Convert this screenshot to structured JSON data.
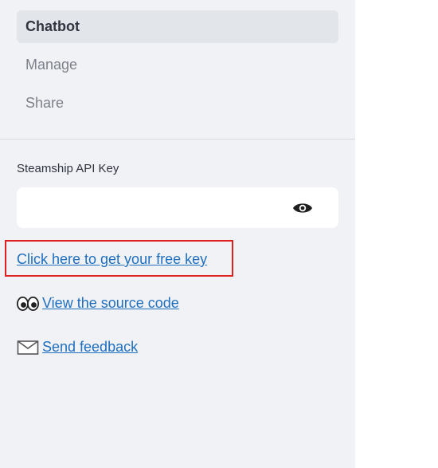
{
  "sidebar": {
    "nav": [
      {
        "label": "Chatbot",
        "active": true
      },
      {
        "label": "Manage",
        "active": false
      },
      {
        "label": "Share",
        "active": false
      }
    ],
    "api_key": {
      "label": "Steamship API Key",
      "value": "",
      "reveal_icon": "eye-icon"
    },
    "links": [
      {
        "label": "Click here to get your free key",
        "icon": null,
        "highlighted": true
      },
      {
        "label": "View the source code",
        "icon": "eyes-emoji-icon"
      },
      {
        "label": "Send feedback",
        "icon": "envelope-icon"
      }
    ]
  },
  "colors": {
    "sidebar_bg": "#f0f2f6",
    "active_nav_bg": "#e2e5ea",
    "link": "#1f6fbf",
    "highlight_border": "#e02020",
    "text": "#31333f",
    "muted_text": "#7d8089"
  }
}
